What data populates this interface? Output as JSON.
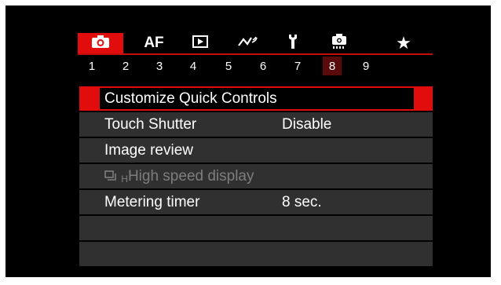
{
  "tabs": [
    {
      "id": "shooting",
      "icon": "camera-icon",
      "label": "",
      "active": true
    },
    {
      "id": "af",
      "icon": "",
      "label": "AF",
      "active": false
    },
    {
      "id": "playback",
      "icon": "play-icon",
      "label": "",
      "active": false
    },
    {
      "id": "wireless",
      "icon": "wireless-icon",
      "label": "",
      "active": false
    },
    {
      "id": "setup",
      "icon": "wrench-icon",
      "label": "",
      "active": false
    },
    {
      "id": "custom",
      "icon": "custom-functions-icon",
      "label": "",
      "active": false
    },
    {
      "id": "mymenu",
      "icon": "star-icon",
      "label": "",
      "active": false
    }
  ],
  "pages": [
    "1",
    "2",
    "3",
    "4",
    "5",
    "6",
    "7",
    "8",
    "9"
  ],
  "active_page": "8",
  "menu": {
    "items": [
      {
        "label": "Customize Quick Controls",
        "value": "",
        "selected": true,
        "disabled": false
      },
      {
        "label": "Touch Shutter",
        "value": "Disable",
        "selected": false,
        "disabled": false
      },
      {
        "label": "Image review",
        "value": "",
        "selected": false,
        "disabled": false
      },
      {
        "label": "High speed display",
        "icon": "continuous-high-icon",
        "icon_sub": "H",
        "value": "",
        "selected": false,
        "disabled": true
      },
      {
        "label": "Metering timer",
        "value": "8 sec.",
        "selected": false,
        "disabled": false
      },
      {
        "label": "",
        "value": ""
      },
      {
        "label": "",
        "value": ""
      }
    ]
  },
  "colors": {
    "accent": "#e10c0c",
    "active_page_bg": "#5a0a0a",
    "row_bg": "#303030",
    "disabled_text": "#7d7d7d"
  }
}
